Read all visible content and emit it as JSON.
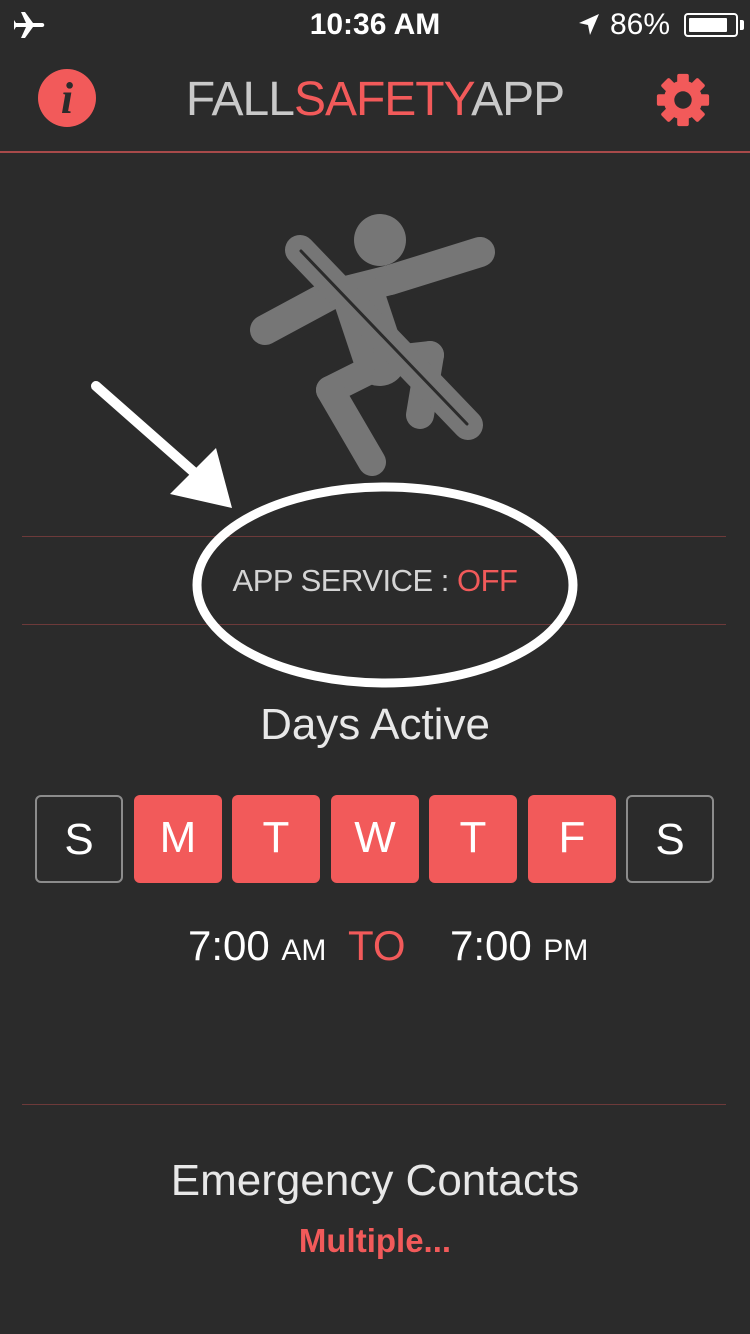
{
  "status_bar": {
    "time": "10:36 AM",
    "battery_percent": "86%",
    "battery_level": 0.86,
    "icons": [
      "airplane-icon",
      "location-arrow-icon",
      "battery-icon"
    ]
  },
  "nav": {
    "title_part1": "FALL",
    "title_part2": "SAFETY",
    "title_part3": "APP",
    "info_glyph": "i",
    "info_icon": "info-icon",
    "settings_icon": "gear-icon"
  },
  "fall_icon": "person-falling-icon",
  "service": {
    "label": "APP SERVICE : ",
    "status": "OFF"
  },
  "annotation": {
    "arrow": "arrow-icon",
    "circle": "highlight-ellipse"
  },
  "days": {
    "heading": "Days Active",
    "items": [
      {
        "label": "S",
        "active": false
      },
      {
        "label": "M",
        "active": true
      },
      {
        "label": "T",
        "active": true
      },
      {
        "label": "W",
        "active": true
      },
      {
        "label": "T",
        "active": true
      },
      {
        "label": "F",
        "active": true
      },
      {
        "label": "S",
        "active": false
      }
    ]
  },
  "schedule": {
    "start_time": "7:00",
    "start_period": "AM",
    "to_label": "TO",
    "end_time": "7:00",
    "end_period": "PM"
  },
  "contacts": {
    "heading": "Emergency Contacts",
    "value": "Multiple..."
  },
  "colors": {
    "background": "#2b2b2b",
    "accent": "#f25a5a",
    "icon_gray": "#767676"
  }
}
